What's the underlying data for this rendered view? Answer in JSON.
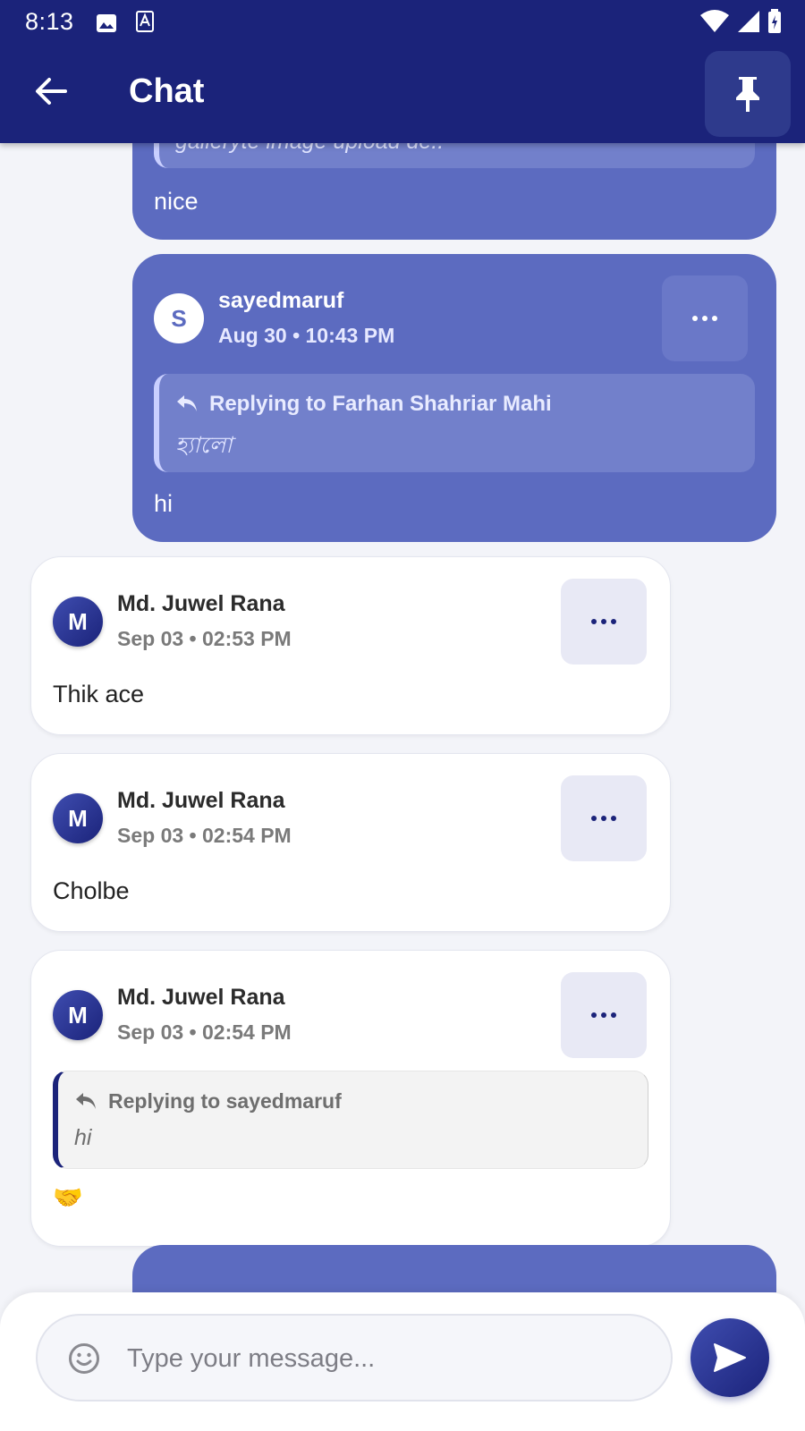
{
  "status_bar": {
    "time": "8:13"
  },
  "app_bar": {
    "title": "Chat"
  },
  "messages": [
    {
      "direction": "outgoing",
      "reply_preview_partial": "galleryte image upload de..",
      "text": "nice"
    },
    {
      "direction": "outgoing",
      "avatar_initial": "S",
      "sender": "sayedmaruf",
      "timestamp": "Aug 30 • 10:43 PM",
      "reply_to": "Replying to Farhan Shahriar Mahi",
      "reply_text": "হ্যালো",
      "text": "hi"
    },
    {
      "direction": "incoming",
      "avatar_initial": "M",
      "sender": "Md. Juwel Rana",
      "timestamp": "Sep 03 • 02:53 PM",
      "text": "Thik ace"
    },
    {
      "direction": "incoming",
      "avatar_initial": "M",
      "sender": "Md. Juwel Rana",
      "timestamp": "Sep 03 • 02:54 PM",
      "text": "Cholbe"
    },
    {
      "direction": "incoming",
      "avatar_initial": "M",
      "sender": "Md. Juwel Rana",
      "timestamp": "Sep 03 • 02:54 PM",
      "reply_to": "Replying to sayedmaruf",
      "reply_text": "hi",
      "text": "🤝"
    }
  ],
  "composer": {
    "placeholder": "Type your message..."
  },
  "colors": {
    "app_bar": "#1b237a",
    "outgoing_bubble": "#5c6bc0",
    "incoming_bubble": "#ffffff",
    "background": "#f3f4f9"
  },
  "icons": {
    "back": "arrow-left-icon",
    "pin": "pin-icon",
    "more": "more-horizontal-icon",
    "reply": "reply-icon",
    "emoji": "emoji-icon",
    "send": "send-icon"
  }
}
